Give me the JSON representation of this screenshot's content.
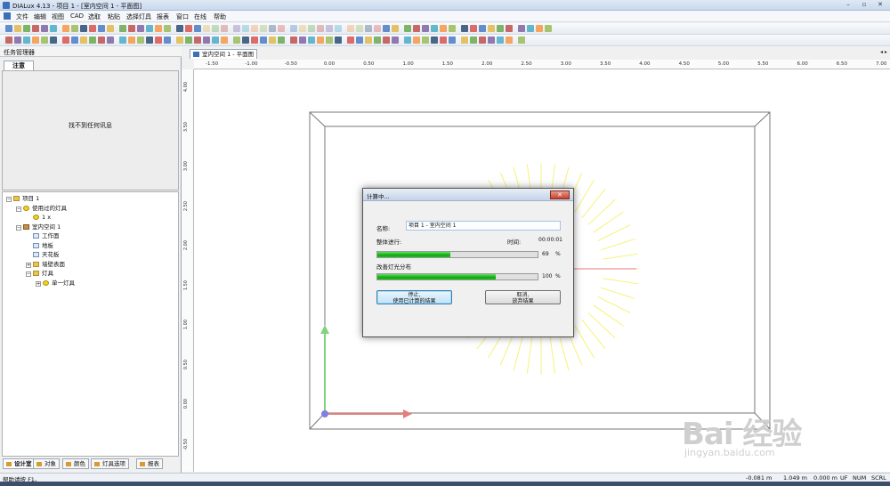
{
  "window": {
    "title": "DIALux 4.13 - 项目 1 - [室内空间 1 - 平面图]"
  },
  "window_buttons": {
    "minimize": "–",
    "restore": "▫",
    "close": "✕"
  },
  "menu": [
    "文件",
    "编辑",
    "视图",
    "CAD",
    "选取",
    "粘贴",
    "选择灯具",
    "报表",
    "窗口",
    "在线",
    "帮助"
  ],
  "left_panel": {
    "title": "任务管理器",
    "notes_tab": "注意",
    "notes_empty": "找不到任何讯息",
    "tree": [
      {
        "label": "项目 1",
        "icon": "folder-icon",
        "level": 0,
        "expander": "−"
      },
      {
        "label": "使用过的灯具",
        "icon": "lamp-icon",
        "level": 1,
        "expander": "−"
      },
      {
        "label": "1 x",
        "icon": "luminaire-icon",
        "level": 2,
        "expander": ""
      },
      {
        "label": "室内空间 1",
        "icon": "room-icon",
        "level": 1,
        "expander": "−"
      },
      {
        "label": "工作面",
        "icon": "plane-icon",
        "level": 2,
        "expander": ""
      },
      {
        "label": "地板",
        "icon": "plane-icon",
        "level": 2,
        "expander": ""
      },
      {
        "label": "天花板",
        "icon": "plane-icon",
        "level": 2,
        "expander": ""
      },
      {
        "label": "墙壁表面",
        "icon": "folder-icon",
        "level": 2,
        "expander": "+"
      },
      {
        "label": "灯具",
        "icon": "folder-icon",
        "level": 2,
        "expander": "−"
      },
      {
        "label": "单一灯具",
        "icon": "lamp-icon",
        "level": 3,
        "expander": "+"
      }
    ],
    "bottom_tabs": [
      "设计室",
      "对象",
      "颜色",
      "灯具选项",
      "报表"
    ]
  },
  "document_tab": "室内空间 1 - 平面图",
  "ruler": {
    "h_labels": [
      "-1.50",
      "-1.00",
      "-0.50",
      "0.00",
      "0.50",
      "1.00",
      "1.50",
      "2.00",
      "2.50",
      "3.00",
      "3.50",
      "4.00",
      "4.50",
      "5.00",
      "5.50",
      "6.00",
      "6.50",
      "7.00"
    ],
    "v_labels": [
      "4.00",
      "3.50",
      "3.00",
      "2.50",
      "2.00",
      "1.50",
      "1.00",
      "0.50",
      "0.00",
      "-0.50"
    ]
  },
  "dialog": {
    "title": "计算中...",
    "close": "✕",
    "name_label": "名称:",
    "name_value": "项目 1 - 室内空间 1",
    "overall_label": "整体进行:",
    "time_label": "时间:",
    "time_value": "00:00:01",
    "overall_percent": "69",
    "overall_fraction": 0.69,
    "distribution_label": "改善灯光分布",
    "distribution_percent": "100",
    "distribution_fraction": 1.0,
    "percent_unit": "%",
    "stop_button_line1": "停止,",
    "stop_button_line2": "使用已计算的结果",
    "cancel_button_line1": "取消,",
    "cancel_button_line2": "放弃结果"
  },
  "statusbar": {
    "help": "帮助请按 F1。",
    "x": "-0.081 m",
    "y": "1.049 m",
    "z": "0.000 m",
    "uf": "UF",
    "num": "NUM",
    "scrl": "SCRL"
  },
  "watermark": {
    "logo": "Bai 经验",
    "url": "jingyan.baidu.com"
  },
  "colors": {
    "progress": "#17b817",
    "x_axis": "#e87b7b",
    "y_axis": "#7fd47f",
    "light_rays": "#f5ef5a"
  }
}
